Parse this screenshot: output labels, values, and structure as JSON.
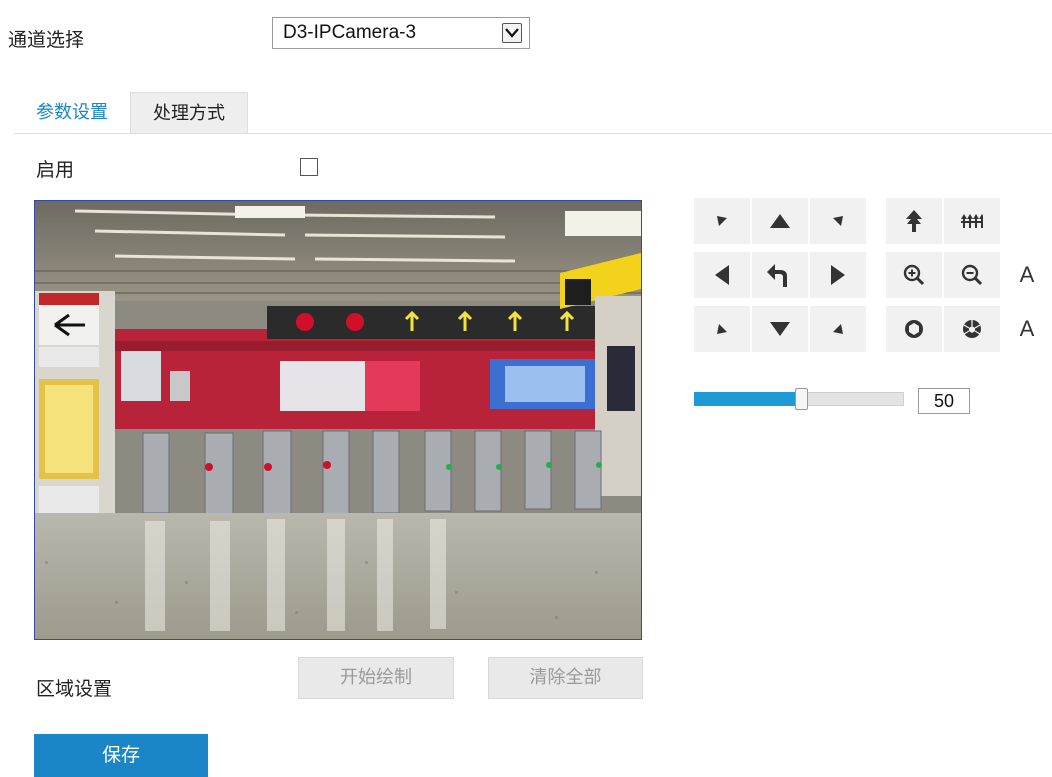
{
  "channel": {
    "label": "通道选择",
    "selected": "D3-IPCamera-3"
  },
  "tabs": [
    {
      "label": "参数设置",
      "active": true
    },
    {
      "label": "处理方式",
      "active": false
    }
  ],
  "enable": {
    "label": "启用",
    "checked": false
  },
  "video": {
    "scene": "subway station turnstile hall"
  },
  "ptz": {
    "buttons": [
      "up-left-arrow-icon",
      "up-arrow-icon",
      "up-right-arrow-icon",
      "left-arrow-icon",
      "return-icon",
      "right-arrow-icon",
      "down-left-arrow-icon",
      "down-arrow-icon",
      "down-right-arrow-icon"
    ],
    "right_buttons": [
      "focus-near-icon",
      "focus-far-icon",
      "zoom-in-icon",
      "zoom-out-icon",
      "iris-open-icon",
      "iris-close-icon"
    ],
    "auto_label_1": "A",
    "auto_label_2": "A"
  },
  "speed": {
    "value": 50,
    "display": "50",
    "fill_fraction": 0.5
  },
  "region": {
    "label": "区域设置",
    "start_draw": "开始绘制",
    "clear_all": "清除全部"
  },
  "save": "保存",
  "colors": {
    "accent": "#1b86c7",
    "slider": "#1e9ad6"
  }
}
